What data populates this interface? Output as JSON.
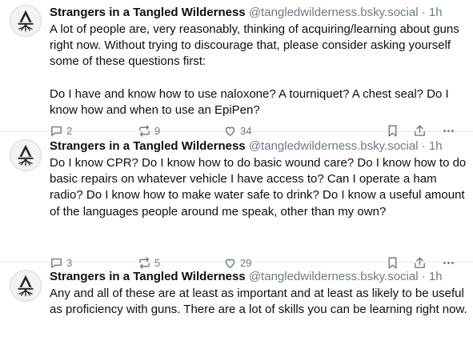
{
  "posts": [
    {
      "author_name": "Strangers in a Tangled Wilderness",
      "handle": "@tangledwilderness.bsky.social",
      "separator": "·",
      "time": "1h",
      "text": "A lot of people are, very reasonably, thinking of acquiring/learning about guns right now. Without trying to discourage that, please consider asking yourself some of these questions first:\n\nDo I have and know how to use naloxone? A tourniquet? A chest seal? Do I know how and when to use an EpiPen?",
      "replies": "2",
      "reposts": "9",
      "likes": "34"
    },
    {
      "author_name": "Strangers in a Tangled Wilderness",
      "handle": "@tangledwilderness.bsky.social",
      "separator": "·",
      "time": "1h",
      "text": "Do I know CPR? Do I know how to do basic wound care? Do I know how to do basic repairs on whatever vehicle I have access to? Can I operate a ham radio? Do I know how to make water safe to drink? Do I know a useful amount of the languages people around me speak, other than my own?",
      "replies": "3",
      "reposts": "5",
      "likes": "29"
    },
    {
      "author_name": "Strangers in a Tangled Wilderness",
      "handle": "@tangledwilderness.bsky.social",
      "separator": "·",
      "time": "1h",
      "text": "Any and all of these are at least as important and at least as likely to be useful as proficiency with guns. There are a lot of skills you can be learning right now."
    }
  ],
  "icons": {
    "reply": "speech-bubble-icon",
    "repost": "repost-arrows-icon",
    "like": "heart-icon",
    "bookmark": "bookmark-icon",
    "share": "share-icon",
    "more": "ellipsis-icon"
  },
  "colors": {
    "text": "#0b0f14",
    "muted": "#6f7a86",
    "divider": "#e6e9ed"
  }
}
